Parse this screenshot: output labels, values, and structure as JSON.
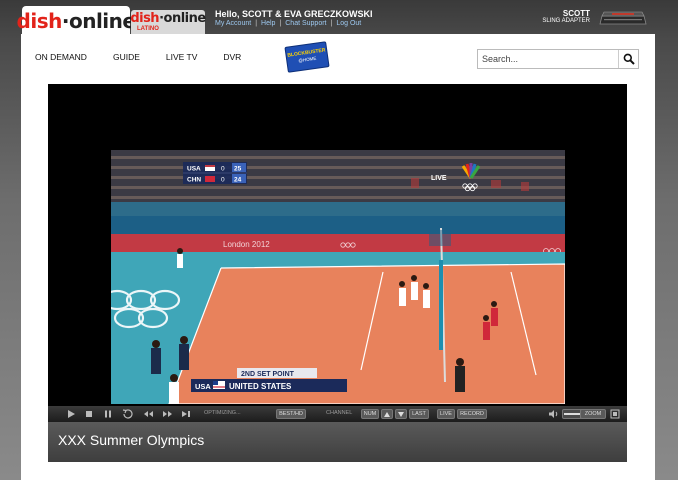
{
  "header": {
    "logo_main": {
      "d": "dish",
      "o": "·online"
    },
    "logo_latino": {
      "d": "dish",
      "o": "·online",
      "sub": "LATINO"
    },
    "greeting": "Hello, SCOTT & EVA GRECZKOWSKI",
    "links": [
      "My Account",
      "Help",
      "Chat Support",
      "Log Out"
    ],
    "device_name": "SCOTT",
    "device_type": "SLING ADAPTER"
  },
  "nav": {
    "items": [
      "ON DEMAND",
      "GUIDE",
      "LIVE TV",
      "DVR"
    ],
    "blockbuster": {
      "line1": "BLOCKBUSTER",
      "line2": "@HOME"
    }
  },
  "search": {
    "placeholder": "Search..."
  },
  "player": {
    "status": "OPTIMIZING...",
    "best_hd": "BEST/HD",
    "channel_label": "CHANNEL",
    "num": "NUM",
    "last": "LAST",
    "live": "LIVE",
    "record": "RECORD",
    "zoom": "ZOOM",
    "title": "XXX Summer Olympics"
  },
  "video_overlay": {
    "scoreboard": [
      {
        "team": "USA",
        "sets": "0",
        "points": "25"
      },
      {
        "team": "CHN",
        "sets": "0",
        "points": "24"
      }
    ],
    "live_badge": "LIVE",
    "banner": "London 2012",
    "lower_third_top": "2ND SET POINT",
    "lower_third_team": "USA",
    "lower_third_name": "UNITED STATES"
  },
  "colors": {
    "brand_red": "#e2231a",
    "link_blue": "#9ec9f0",
    "court_orange": "#e8825c",
    "court_teal": "#3fa6b8"
  }
}
